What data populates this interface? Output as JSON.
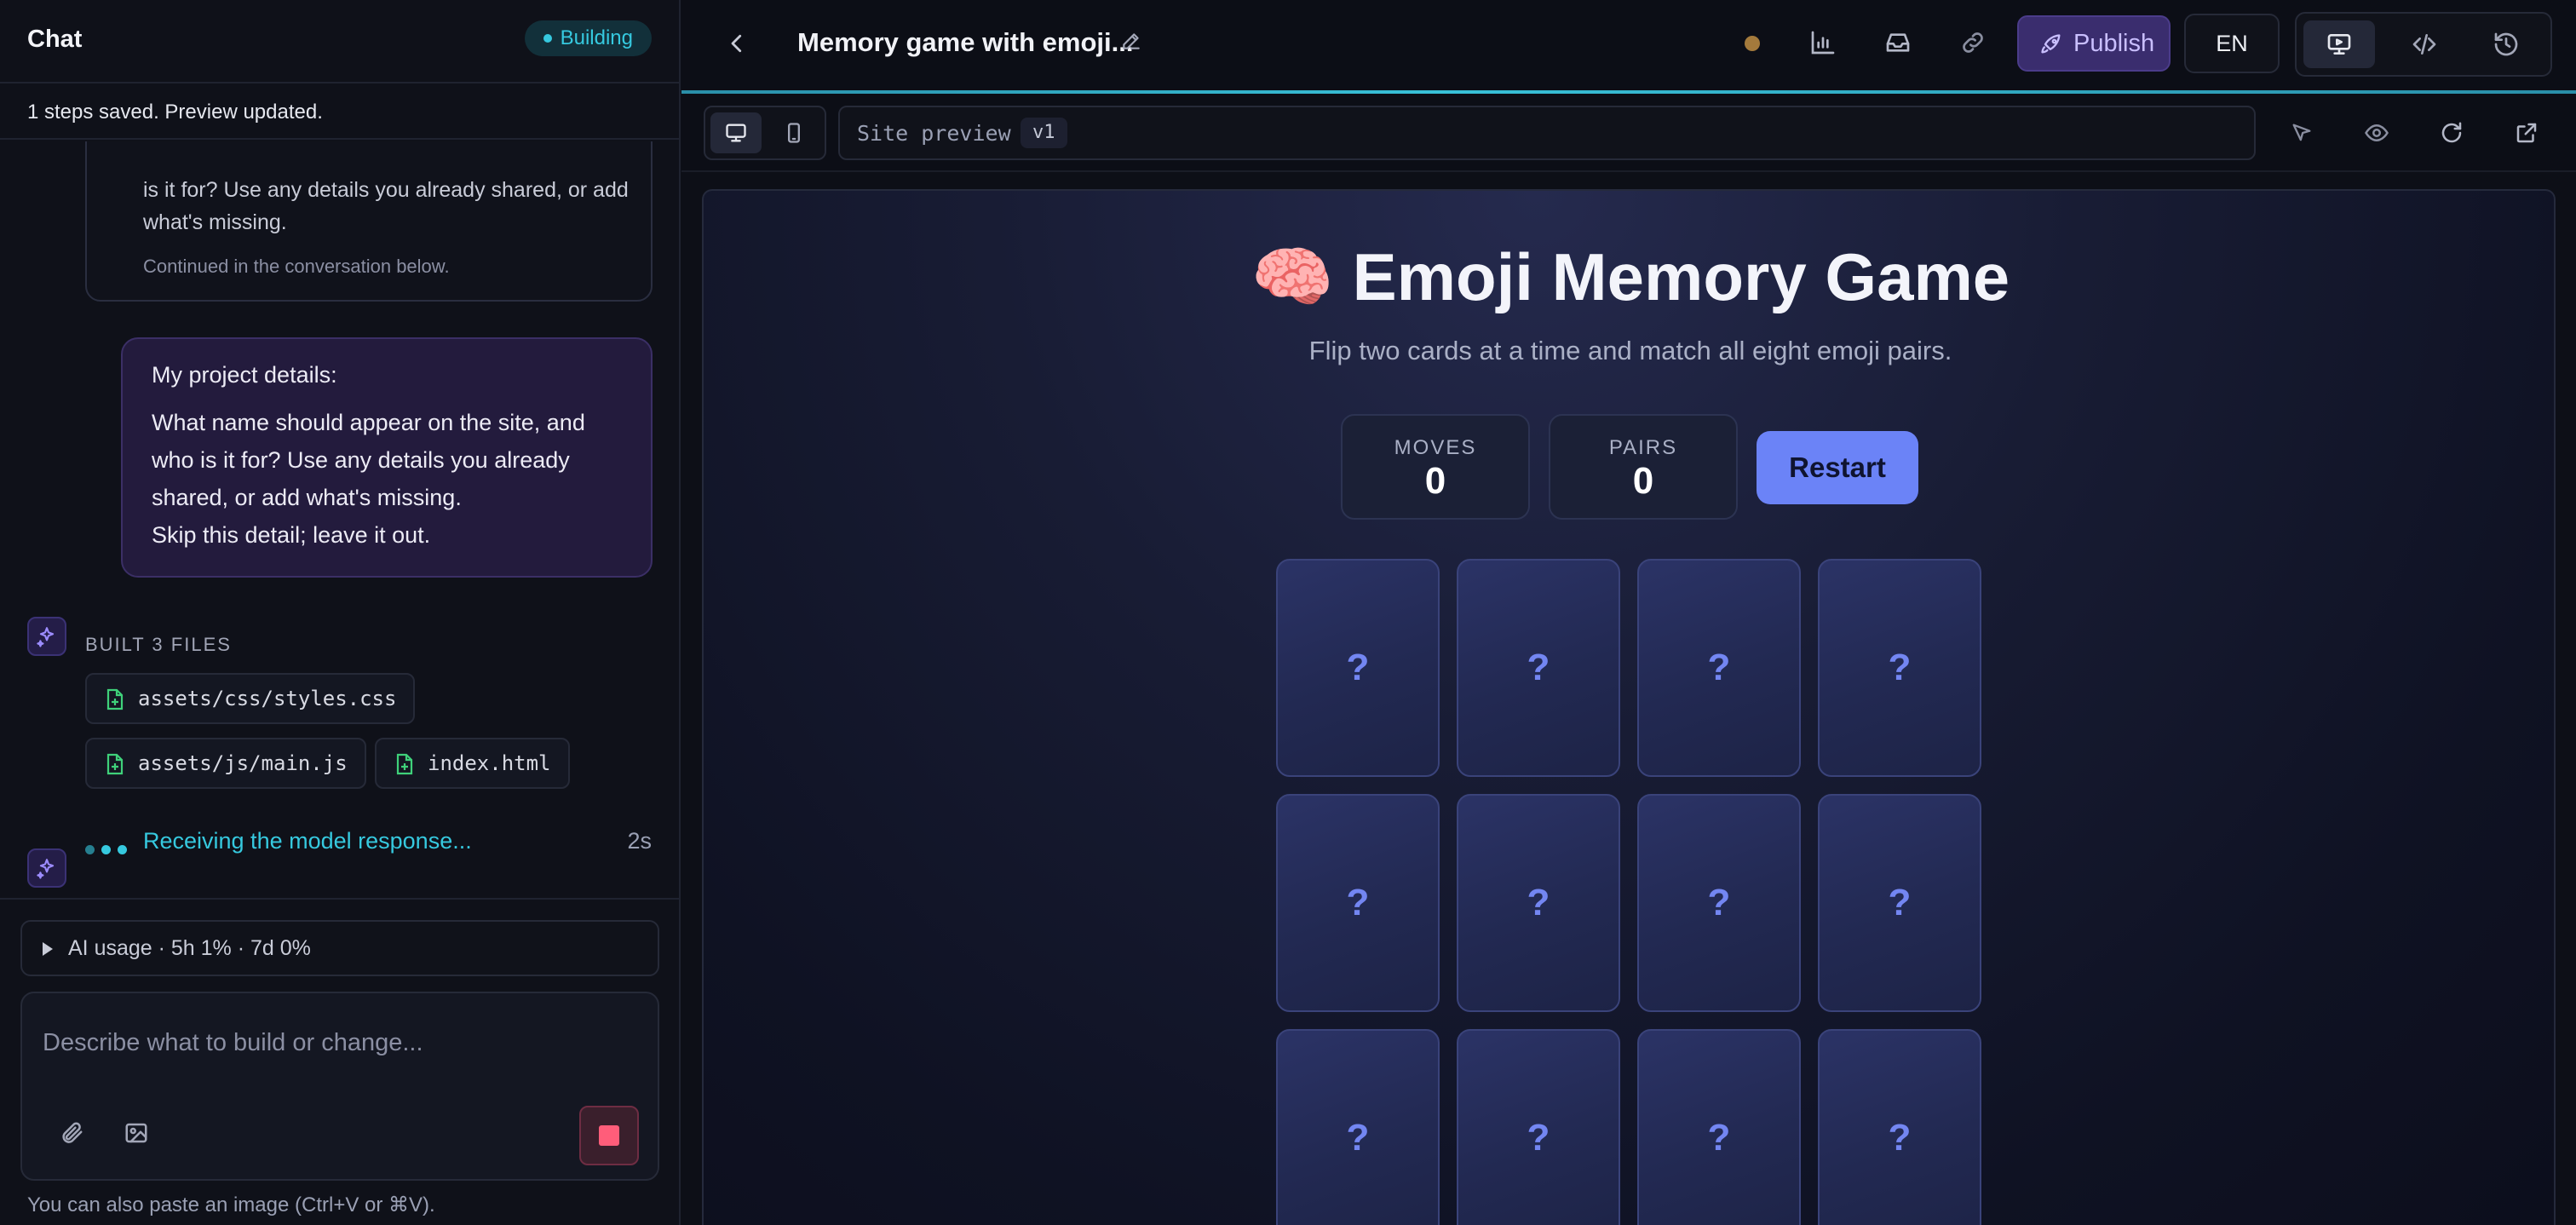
{
  "chat": {
    "title": "Chat",
    "status_badge": "Building",
    "save_status": "1 steps saved. Preview updated.",
    "previous_message": {
      "text": "is it for? Use any details you already shared, or add what's missing.",
      "note": "Continued in the conversation below."
    },
    "user_message": {
      "heading": "My project details:",
      "body": "What name should appear on the site, and who is it for? Use any details you already shared, or add what's missing.",
      "extra": "Skip this detail; leave it out."
    },
    "built": {
      "label": "BUILT 3 FILES",
      "files": [
        "assets/css/styles.css",
        "assets/js/main.js",
        "index.html"
      ]
    },
    "receiving": {
      "text": "Receiving the model response...",
      "elapsed": "2s"
    },
    "ai_usage": "AI usage · 5h 1% · 7d 0%",
    "composer": {
      "placeholder": "Describe what to build or change...",
      "value": ""
    },
    "paste_hint": "You can also paste an image (Ctrl+V or ⌘V)."
  },
  "topbar": {
    "project_title": "Memory game with emoji...",
    "publish_label": "Publish",
    "language": "EN",
    "icons": [
      "back-icon",
      "pencil-icon",
      "bar-chart-icon",
      "inbox-icon",
      "link-icon",
      "rocket-icon",
      "monitor-icon",
      "code-icon",
      "history-icon"
    ]
  },
  "preview_toolbar": {
    "address_label": "Site preview",
    "version": "v1",
    "icons": [
      "desktop-icon",
      "mobile-icon",
      "cursor-icon",
      "eye-icon",
      "reload-icon",
      "external-link-icon"
    ]
  },
  "site": {
    "title": "🧠 Emoji Memory Game",
    "subtitle": "Flip two cards at a time and match all eight emoji pairs.",
    "moves_label": "MOVES",
    "moves_value": "0",
    "pairs_label": "PAIRS",
    "pairs_value": "0",
    "restart_label": "Restart",
    "cards": [
      "?",
      "?",
      "?",
      "?",
      "?",
      "?",
      "?",
      "?",
      "?",
      "?",
      "?",
      "?"
    ]
  },
  "colors": {
    "accent_cyan": "#36c9df",
    "publish_purple": "#3a2d6e",
    "restart_blue": "#6b83f7",
    "stop_red": "#ff5d7a"
  }
}
